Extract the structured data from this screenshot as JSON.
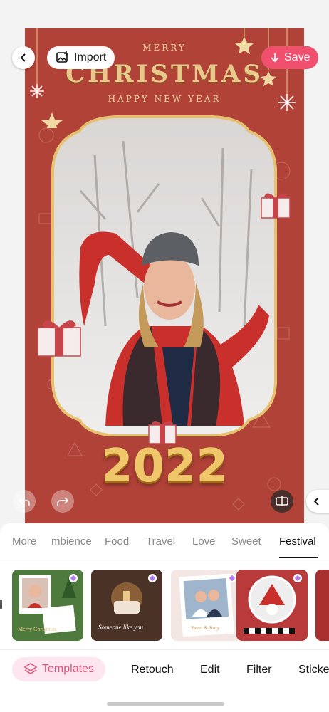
{
  "header": {
    "back_icon": "chevron-left-icon",
    "import_label": "Import",
    "save_label": "Save",
    "save_color": "#f0506e"
  },
  "canvas": {
    "line1": "MERRY",
    "line2": "CHRISTMAS",
    "line3": "HAPPY NEW YEAR",
    "year": "2022",
    "background_color": "#b14238",
    "accent_gold": "#e8c98b"
  },
  "editor_controls": {
    "undo_icon": "undo-icon",
    "redo_icon": "redo-icon",
    "compare_icon": "compare-icon",
    "collapse_icon": "chevron-left-icon"
  },
  "categories": [
    {
      "label": "More",
      "active": false
    },
    {
      "label": "mbience",
      "active": false
    },
    {
      "label": "Food",
      "active": false
    },
    {
      "label": "Travel",
      "active": false
    },
    {
      "label": "Love",
      "active": false
    },
    {
      "label": "Sweet",
      "active": false
    },
    {
      "label": "Festival",
      "active": true
    }
  ],
  "templates": [
    {
      "name": "christmas-green-template",
      "text": "Merry Christmas",
      "premium": true
    },
    {
      "name": "birthday-cake-template",
      "text": "Someone like you",
      "premium": true
    },
    {
      "name": "couple-polaroid-template",
      "text": "Sweet & Story",
      "premium": true
    },
    {
      "name": "santa-circle-template",
      "text": "",
      "premium": true
    },
    {
      "name": "red-partial-template",
      "text": "",
      "premium": false
    }
  ],
  "bottom_nav": {
    "templates_label": "Templates",
    "templates_icon": "layers-icon",
    "items": [
      "Retouch",
      "Edit",
      "Filter",
      "Sticke"
    ]
  }
}
